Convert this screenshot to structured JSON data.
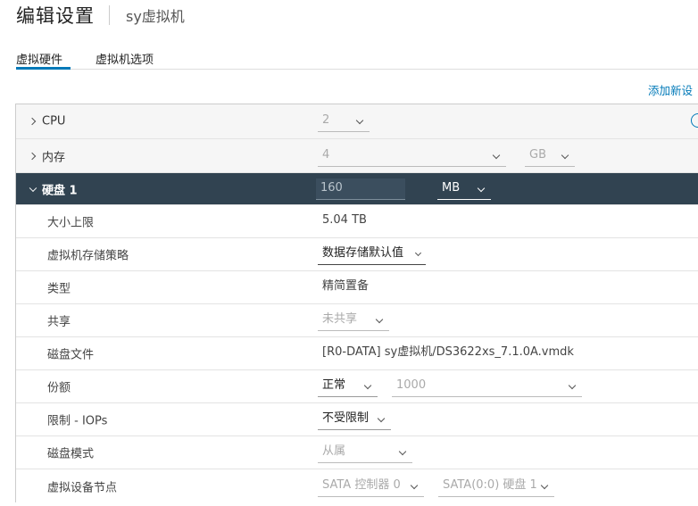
{
  "header": {
    "title": "编辑设置",
    "vm_name": "sy虚拟机"
  },
  "tabs": [
    {
      "label": "虚拟硬件",
      "active": true
    },
    {
      "label": "虚拟机选项",
      "active": false
    }
  ],
  "add_device_label": "添加新设",
  "rows": {
    "cpu": {
      "label": "CPU",
      "value": "2"
    },
    "memory": {
      "label": "内存",
      "value": "4",
      "unit": "GB"
    },
    "disk": {
      "label": "硬盘 1",
      "value": "160",
      "unit": "MB"
    },
    "max_size": {
      "label": "大小上限",
      "value": "5.04 TB"
    },
    "storage_policy": {
      "label": "虚拟机存储策略",
      "value": "数据存储默认值"
    },
    "type": {
      "label": "类型",
      "value": "精简置备"
    },
    "sharing": {
      "label": "共享",
      "value": "未共享"
    },
    "disk_file": {
      "label": "磁盘文件",
      "value": "[R0-DATA] sy虚拟机/DS3622xs_7.1.0A.vmdk"
    },
    "shares": {
      "label": "份额",
      "value": "正常",
      "amount": "1000"
    },
    "limit_iops": {
      "label": "限制 - IOPs",
      "value": "不受限制"
    },
    "disk_mode": {
      "label": "磁盘模式",
      "value": "从属"
    },
    "device_node": {
      "label": "虚拟设备节点",
      "controller": "SATA 控制器 0",
      "node": "SATA(0:0) 硬盘 1"
    }
  },
  "colors": {
    "accent": "#0079b8",
    "expanded_row_bg": "#314351"
  }
}
